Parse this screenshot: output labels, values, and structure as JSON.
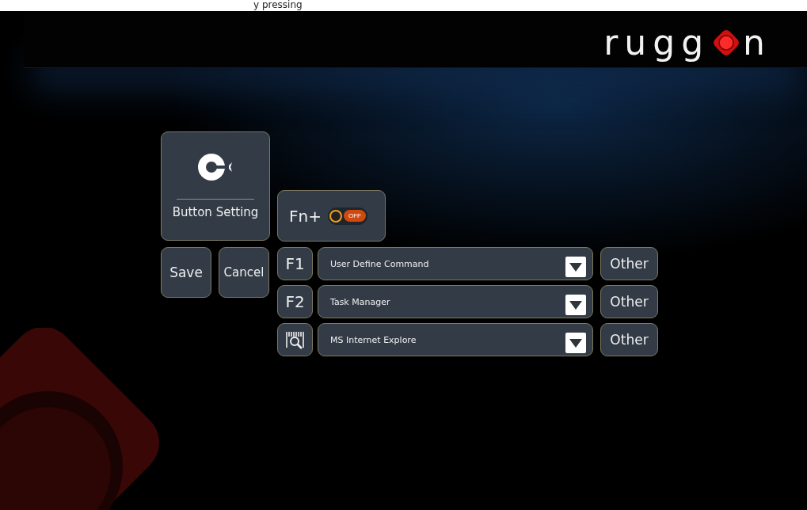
{
  "top_strip": {
    "text": "y pressing"
  },
  "logo": {
    "before": "rugg",
    "after": "n"
  },
  "setting_tile": {
    "label": "Button Setting"
  },
  "fn_toggle": {
    "label": "Fn+",
    "state_text": "OFF",
    "on": false
  },
  "actions": [
    "Save",
    "Cancel"
  ],
  "keys": [
    {
      "kind": "text",
      "key": "F1",
      "command": "User Define Command",
      "other": "Other"
    },
    {
      "kind": "text",
      "key": "F2",
      "command": "Task Manager",
      "other": "Other"
    },
    {
      "kind": "scan",
      "command": "MS Internet Explore",
      "other": "Other"
    }
  ]
}
